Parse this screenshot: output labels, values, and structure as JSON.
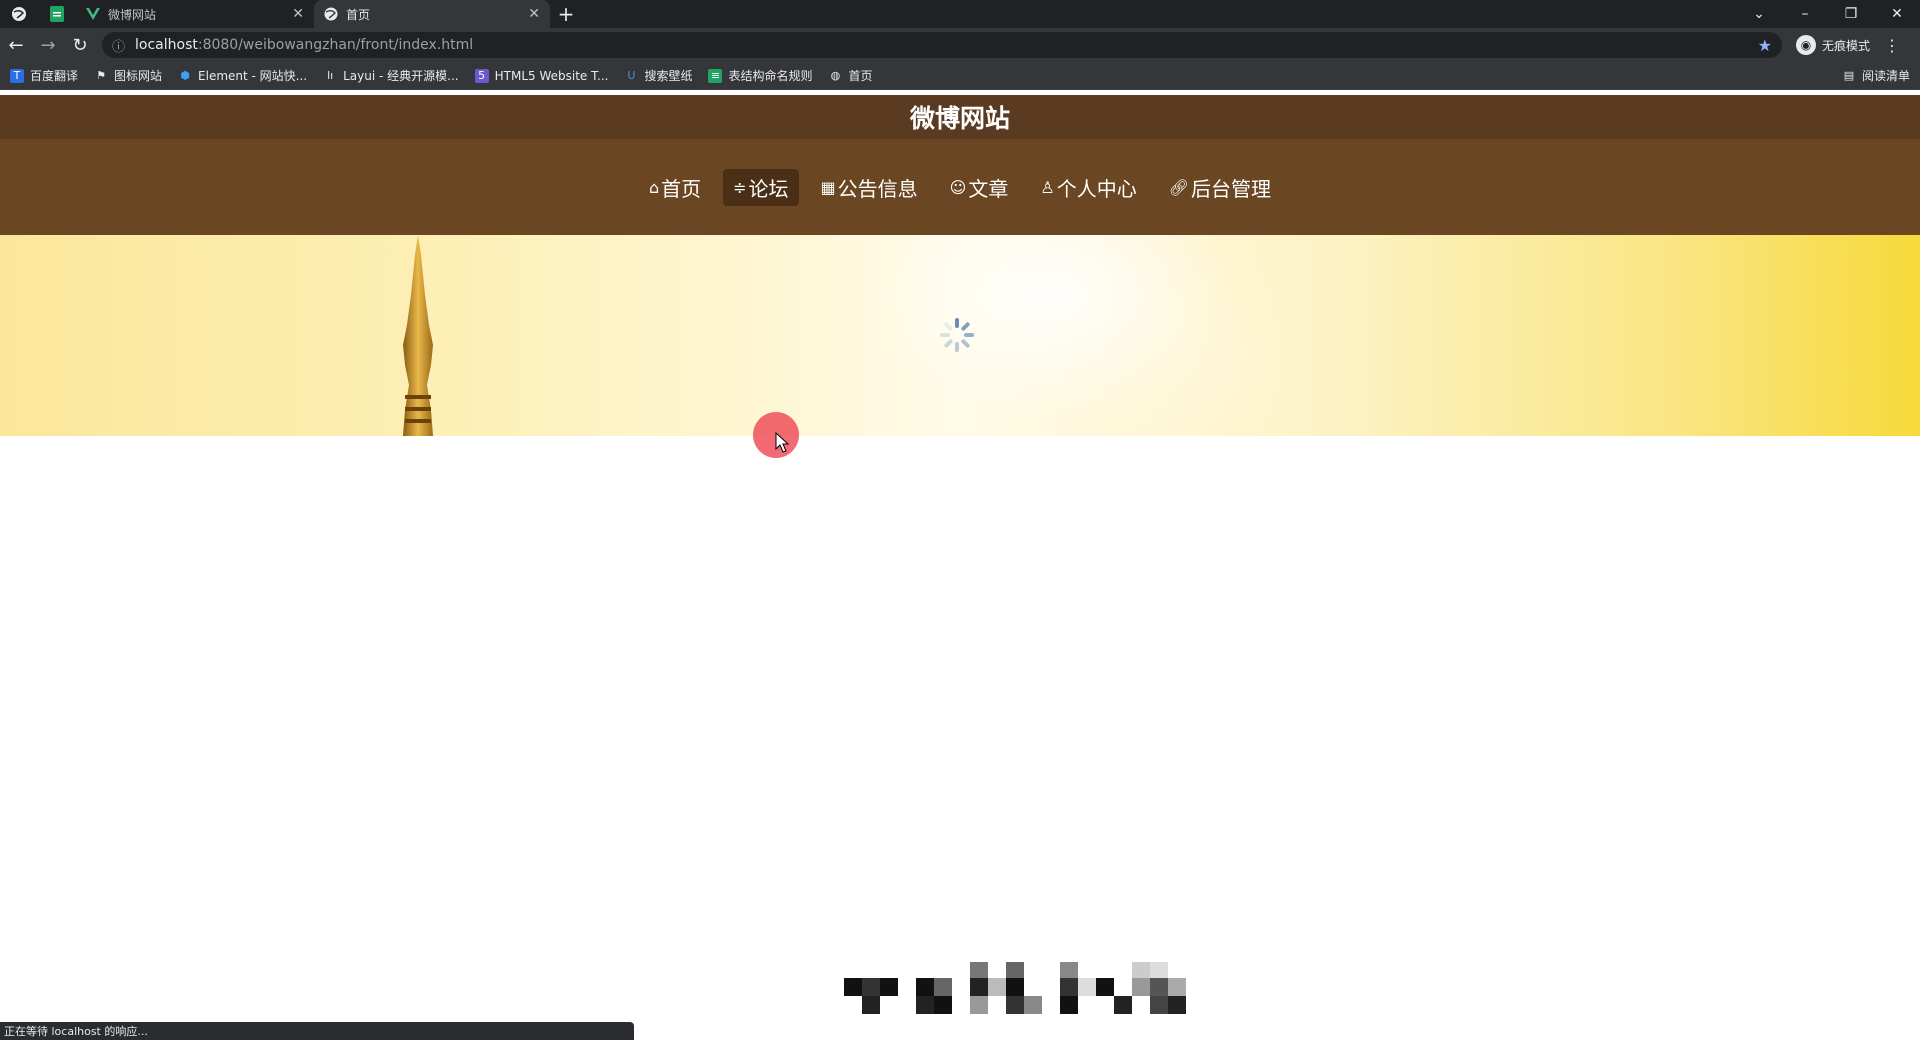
{
  "browser": {
    "tabs": [
      {
        "title": "",
        "icon": "sheet-icon"
      },
      {
        "title": "微博网站",
        "icon": "vue-icon"
      },
      {
        "title": "首页",
        "icon": "globe-icon"
      }
    ],
    "url": {
      "host": "localhost",
      "path": ":8080/weibowangzhan/front/index.html"
    },
    "profile_label": "无痕模式",
    "bookmarks": [
      {
        "label": "百度翻译",
        "icon": "translate-icon"
      },
      {
        "label": "图标网站",
        "icon": "flag-icon"
      },
      {
        "label": "Element - 网站快...",
        "icon": "element-icon"
      },
      {
        "label": "Layui - 经典开源模...",
        "icon": "layui-icon"
      },
      {
        "label": "HTML5 Website T...",
        "icon": "html5-icon"
      },
      {
        "label": "搜索壁纸",
        "icon": "wallpaper-icon"
      },
      {
        "label": "表结构命名规则",
        "icon": "sheet-icon"
      },
      {
        "label": "首页",
        "icon": "globe-icon"
      }
    ],
    "reading_list_label": "阅读清单",
    "status_text": "正在等待 localhost 的响应..."
  },
  "site": {
    "title": "微博网站",
    "nav": [
      {
        "label": "首页",
        "icon": "home-icon",
        "active": false
      },
      {
        "label": "论坛",
        "icon": "forum-icon",
        "active": true
      },
      {
        "label": "公告信息",
        "icon": "notice-icon",
        "active": false
      },
      {
        "label": "文章",
        "icon": "article-icon",
        "active": false
      },
      {
        "label": "个人中心",
        "icon": "user-icon",
        "active": false
      },
      {
        "label": "后台管理",
        "icon": "link-icon",
        "active": false
      }
    ]
  },
  "colors": {
    "title_bar": "#5a3a20",
    "nav_bar": "#6b4623",
    "nav_active": "#4a2f16",
    "banner_accent": "#f7d93a"
  }
}
